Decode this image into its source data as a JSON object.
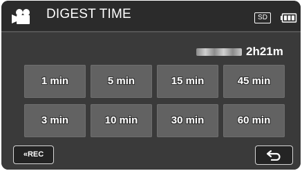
{
  "header": {
    "mode_icon": "video-camera-icon",
    "title": "DIGEST TIME",
    "media_badge": "SD",
    "battery_icon": "battery-full-icon"
  },
  "remaining": {
    "time": "2h21m"
  },
  "options": [
    {
      "label": "1 min"
    },
    {
      "label": "5 min"
    },
    {
      "label": "15 min"
    },
    {
      "label": "45 min"
    },
    {
      "label": "3 min"
    },
    {
      "label": "10 min"
    },
    {
      "label": "30 min"
    },
    {
      "label": "60 min"
    }
  ],
  "footer": {
    "rec_label": "«REC",
    "back_icon": "return-arrow-icon"
  },
  "colors": {
    "background": "#3a3a3a",
    "header": "#2b2b2b",
    "button": "#626262",
    "text": "#ffffff"
  }
}
